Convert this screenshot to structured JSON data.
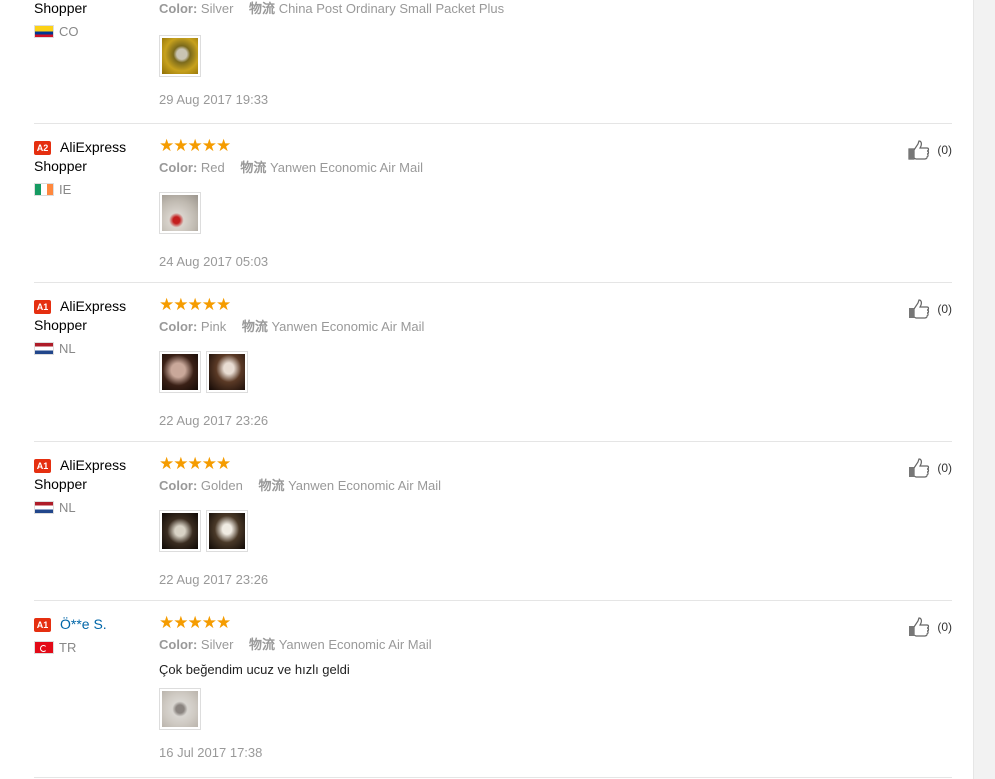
{
  "reviews": [
    {
      "badge": "",
      "buyer_line1": "",
      "buyer_line2": "Shopper",
      "country_code": "CO",
      "show_stars": false,
      "color_key": "Color:",
      "color_value": "Silver",
      "shipping_key": "物流",
      "shipping_value": "China Post Ordinary Small Packet Plus",
      "comment": "",
      "images": [
        "yellow"
      ],
      "date": "29 Aug 2017 19:33",
      "likes": ""
    },
    {
      "badge": "A2",
      "buyer_line1": "AliExpress",
      "buyer_line2": "Shopper",
      "country_code": "IE",
      "show_stars": true,
      "stars": "★★★★★",
      "color_key": "Color:",
      "color_value": "Red",
      "shipping_key": "物流",
      "shipping_value": "Yanwen Economic Air Mail",
      "comment": "",
      "images": [
        "red"
      ],
      "date": "24 Aug 2017 05:03",
      "likes": "(0)"
    },
    {
      "badge": "A1",
      "buyer_line1": "AliExpress",
      "buyer_line2": "Shopper",
      "country_code": "NL",
      "show_stars": true,
      "stars": "★★★★★",
      "color_key": "Color:",
      "color_value": "Pink",
      "shipping_key": "物流",
      "shipping_value": "Yanwen Economic Air Mail",
      "comment": "",
      "images": [
        "pink1",
        "pink2"
      ],
      "date": "22 Aug 2017 23:26",
      "likes": "(0)"
    },
    {
      "badge": "A1",
      "buyer_line1": "AliExpress",
      "buyer_line2": "Shopper",
      "country_code": "NL",
      "show_stars": true,
      "stars": "★★★★★",
      "color_key": "Color:",
      "color_value": "Golden",
      "shipping_key": "物流",
      "shipping_value": "Yanwen Economic Air Mail",
      "comment": "",
      "images": [
        "gold1",
        "gold2"
      ],
      "date": "22 Aug 2017 23:26",
      "likes": "(0)"
    },
    {
      "badge": "A1",
      "buyer_line1": "Ö**e S.",
      "buyer_line2": "",
      "buyer_is_link": true,
      "country_code": "TR",
      "show_stars": true,
      "stars": "★★★★★",
      "color_key": "Color:",
      "color_value": "Silver",
      "shipping_key": "物流",
      "shipping_value": "Yanwen Economic Air Mail",
      "comment": "Çok beğendim ucuz ve hızlı geldi",
      "images": [
        "silver"
      ],
      "date": "16 Jul 2017 17:38",
      "likes": "(0)"
    }
  ],
  "colors": {
    "star": "#f59c00",
    "badge": "#e52f10",
    "link": "#0066a8",
    "muted": "#999999"
  },
  "icons": {
    "like": "thumbs-up-icon"
  }
}
